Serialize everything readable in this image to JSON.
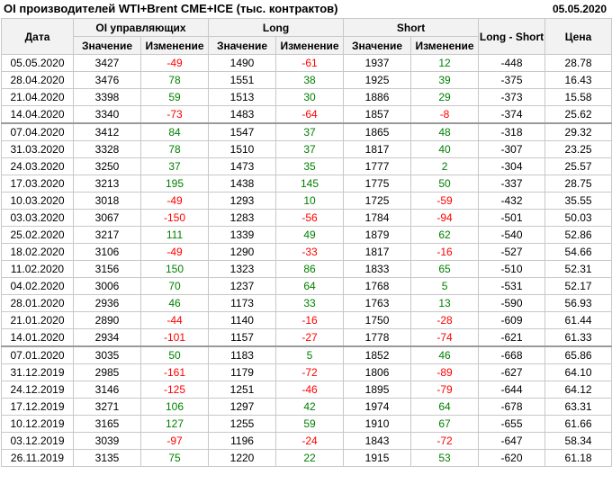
{
  "header": {
    "title": "OI производителей WTI+Brent CME+ICE (тыс. контрактов)",
    "date": "05.05.2020"
  },
  "columns": {
    "date": "Дата",
    "oi": "OI управляющих",
    "long": "Long",
    "short": "Short",
    "long_short": "Long - Short",
    "price": "Цена",
    "value": "Значение",
    "change": "Изменение"
  },
  "rows": [
    {
      "date": "05.05.2020",
      "oi": "3427",
      "oi_chg": "-49",
      "long": "1490",
      "long_chg": "-61",
      "short": "1937",
      "short_chg": "12",
      "ls": "-448",
      "price": "28.78"
    },
    {
      "date": "28.04.2020",
      "oi": "3476",
      "oi_chg": "78",
      "long": "1551",
      "long_chg": "38",
      "short": "1925",
      "short_chg": "39",
      "ls": "-375",
      "price": "16.43"
    },
    {
      "date": "21.04.2020",
      "oi": "3398",
      "oi_chg": "59",
      "long": "1513",
      "long_chg": "30",
      "short": "1886",
      "short_chg": "29",
      "ls": "-373",
      "price": "15.58"
    },
    {
      "date": "14.04.2020",
      "oi": "3340",
      "oi_chg": "-73",
      "long": "1483",
      "long_chg": "-64",
      "short": "1857",
      "short_chg": "-8",
      "ls": "-374",
      "price": "25.62"
    },
    {
      "date": "07.04.2020",
      "oi": "3412",
      "oi_chg": "84",
      "long": "1547",
      "long_chg": "37",
      "short": "1865",
      "short_chg": "48",
      "ls": "-318",
      "price": "29.32"
    },
    {
      "date": "31.03.2020",
      "oi": "3328",
      "oi_chg": "78",
      "long": "1510",
      "long_chg": "37",
      "short": "1817",
      "short_chg": "40",
      "ls": "-307",
      "price": "23.25"
    },
    {
      "date": "24.03.2020",
      "oi": "3250",
      "oi_chg": "37",
      "long": "1473",
      "long_chg": "35",
      "short": "1777",
      "short_chg": "2",
      "ls": "-304",
      "price": "25.57"
    },
    {
      "date": "17.03.2020",
      "oi": "3213",
      "oi_chg": "195",
      "long": "1438",
      "long_chg": "145",
      "short": "1775",
      "short_chg": "50",
      "ls": "-337",
      "price": "28.75"
    },
    {
      "date": "10.03.2020",
      "oi": "3018",
      "oi_chg": "-49",
      "long": "1293",
      "long_chg": "10",
      "short": "1725",
      "short_chg": "-59",
      "ls": "-432",
      "price": "35.55"
    },
    {
      "date": "03.03.2020",
      "oi": "3067",
      "oi_chg": "-150",
      "long": "1283",
      "long_chg": "-56",
      "short": "1784",
      "short_chg": "-94",
      "ls": "-501",
      "price": "50.03"
    },
    {
      "date": "25.02.2020",
      "oi": "3217",
      "oi_chg": "111",
      "long": "1339",
      "long_chg": "49",
      "short": "1879",
      "short_chg": "62",
      "ls": "-540",
      "price": "52.86"
    },
    {
      "date": "18.02.2020",
      "oi": "3106",
      "oi_chg": "-49",
      "long": "1290",
      "long_chg": "-33",
      "short": "1817",
      "short_chg": "-16",
      "ls": "-527",
      "price": "54.66"
    },
    {
      "date": "11.02.2020",
      "oi": "3156",
      "oi_chg": "150",
      "long": "1323",
      "long_chg": "86",
      "short": "1833",
      "short_chg": "65",
      "ls": "-510",
      "price": "52.31"
    },
    {
      "date": "04.02.2020",
      "oi": "3006",
      "oi_chg": "70",
      "long": "1237",
      "long_chg": "64",
      "short": "1768",
      "short_chg": "5",
      "ls": "-531",
      "price": "52.17"
    },
    {
      "date": "28.01.2020",
      "oi": "2936",
      "oi_chg": "46",
      "long": "1173",
      "long_chg": "33",
      "short": "1763",
      "short_chg": "13",
      "ls": "-590",
      "price": "56.93"
    },
    {
      "date": "21.01.2020",
      "oi": "2890",
      "oi_chg": "-44",
      "long": "1140",
      "long_chg": "-16",
      "short": "1750",
      "short_chg": "-28",
      "ls": "-609",
      "price": "61.44"
    },
    {
      "date": "14.01.2020",
      "oi": "2934",
      "oi_chg": "-101",
      "long": "1157",
      "long_chg": "-27",
      "short": "1778",
      "short_chg": "-74",
      "ls": "-621",
      "price": "61.33"
    },
    {
      "date": "07.01.2020",
      "oi": "3035",
      "oi_chg": "50",
      "long": "1183",
      "long_chg": "5",
      "short": "1852",
      "short_chg": "46",
      "ls": "-668",
      "price": "65.86"
    },
    {
      "date": "31.12.2019",
      "oi": "2985",
      "oi_chg": "-161",
      "long": "1179",
      "long_chg": "-72",
      "short": "1806",
      "short_chg": "-89",
      "ls": "-627",
      "price": "64.10"
    },
    {
      "date": "24.12.2019",
      "oi": "3146",
      "oi_chg": "-125",
      "long": "1251",
      "long_chg": "-46",
      "short": "1895",
      "short_chg": "-79",
      "ls": "-644",
      "price": "64.12"
    },
    {
      "date": "17.12.2019",
      "oi": "3271",
      "oi_chg": "106",
      "long": "1297",
      "long_chg": "42",
      "short": "1974",
      "short_chg": "64",
      "ls": "-678",
      "price": "63.31"
    },
    {
      "date": "10.12.2019",
      "oi": "3165",
      "oi_chg": "127",
      "long": "1255",
      "long_chg": "59",
      "short": "1910",
      "short_chg": "67",
      "ls": "-655",
      "price": "61.66"
    },
    {
      "date": "03.12.2019",
      "oi": "3039",
      "oi_chg": "-97",
      "long": "1196",
      "long_chg": "-24",
      "short": "1843",
      "short_chg": "-72",
      "ls": "-647",
      "price": "58.34"
    },
    {
      "date": "26.11.2019",
      "oi": "3135",
      "oi_chg": "75",
      "long": "1220",
      "long_chg": "22",
      "short": "1915",
      "short_chg": "53",
      "ls": "-620",
      "price": "61.18"
    }
  ],
  "colors": {
    "positive": "#008000",
    "negative": "#ff0000",
    "header_bg": "#f2f2f2",
    "grid": "#c8c8c8"
  }
}
